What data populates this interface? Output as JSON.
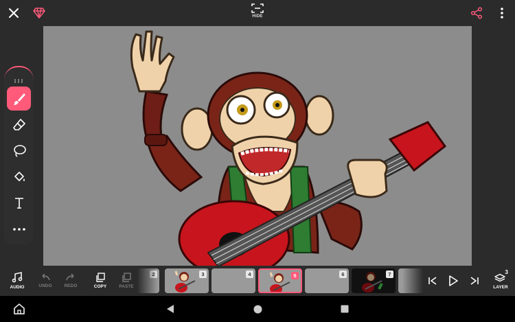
{
  "header": {
    "close_icon": "close-icon",
    "premium_icon": "diamond-icon",
    "hide_label": "HIDE",
    "share_icon": "share-icon",
    "more_icon": "more-vertical-icon"
  },
  "tools": [
    {
      "name": "brush",
      "icon": "brush-icon",
      "active": true
    },
    {
      "name": "eraser",
      "icon": "eraser-icon",
      "active": false
    },
    {
      "name": "lasso",
      "icon": "lasso-icon",
      "active": false
    },
    {
      "name": "fill",
      "icon": "paint-bucket-icon",
      "active": false
    },
    {
      "name": "text",
      "icon": "text-icon",
      "active": false
    },
    {
      "name": "more",
      "icon": "more-horizontal-icon",
      "active": false
    }
  ],
  "bottombar": {
    "audio_label": "AUDIO",
    "undo_label": "UNDO",
    "redo_label": "REDO",
    "copy_label": "COPY",
    "paste_label": "PASTE",
    "layer_label": "LAYER",
    "layer_count": "3"
  },
  "frames": [
    {
      "number": "2",
      "thumb": "blank"
    },
    {
      "number": "3",
      "thumb": "monkey"
    },
    {
      "number": "4",
      "thumb": "blank"
    },
    {
      "number": "5",
      "thumb": "monkey",
      "selected": true
    },
    {
      "number": "6",
      "thumb": "blank"
    },
    {
      "number": "7",
      "thumb": "monkey-dark"
    }
  ],
  "colors": {
    "accent": "#ff5a7a",
    "canvas": "#8c8c8c",
    "toolbar": "#2e2e2e",
    "background": "#2b2b2b"
  }
}
